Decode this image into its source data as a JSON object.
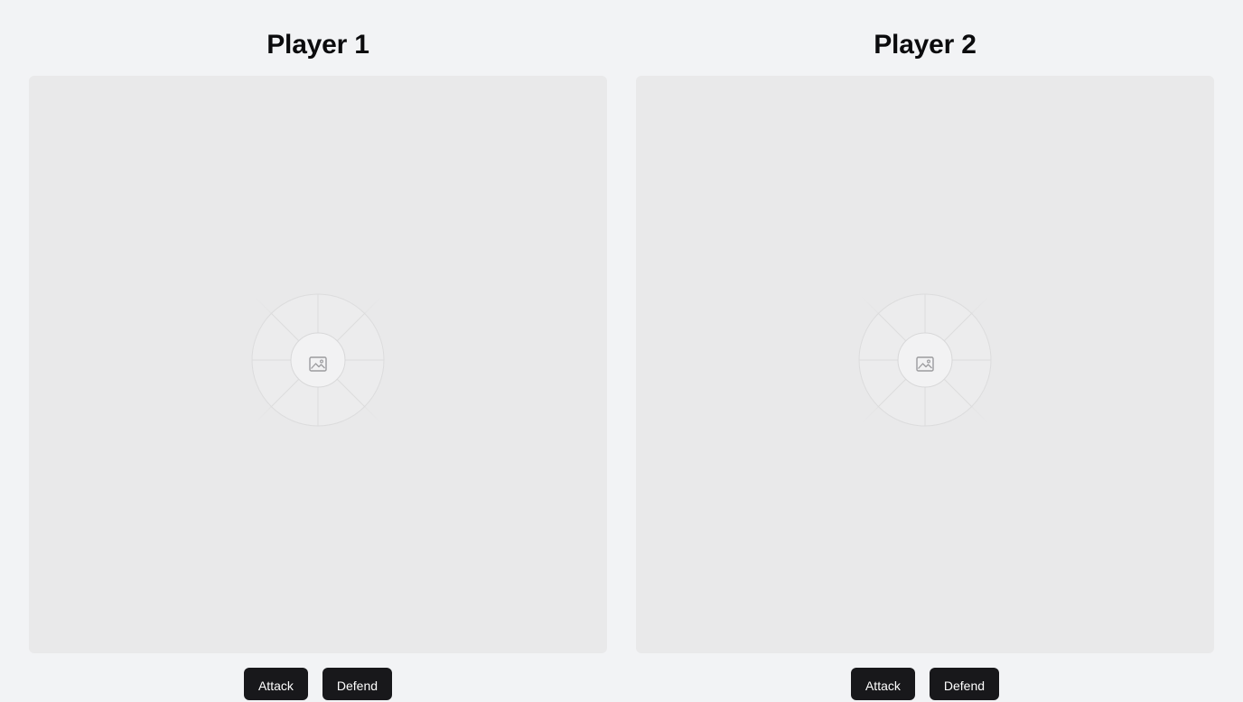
{
  "players": [
    {
      "title": "Player 1",
      "image_icon": "image-placeholder-icon",
      "actions": {
        "attack_label": "Attack",
        "defend_label": "Defend"
      }
    },
    {
      "title": "Player 2",
      "image_icon": "image-placeholder-icon",
      "actions": {
        "attack_label": "Attack",
        "defend_label": "Defend"
      }
    }
  ],
  "colors": {
    "page_background": "#f2f3f5",
    "image_frame": "#e9e9ea",
    "button_background": "#18181b",
    "button_text": "#ffffff",
    "title_text": "#0b0b0d"
  }
}
